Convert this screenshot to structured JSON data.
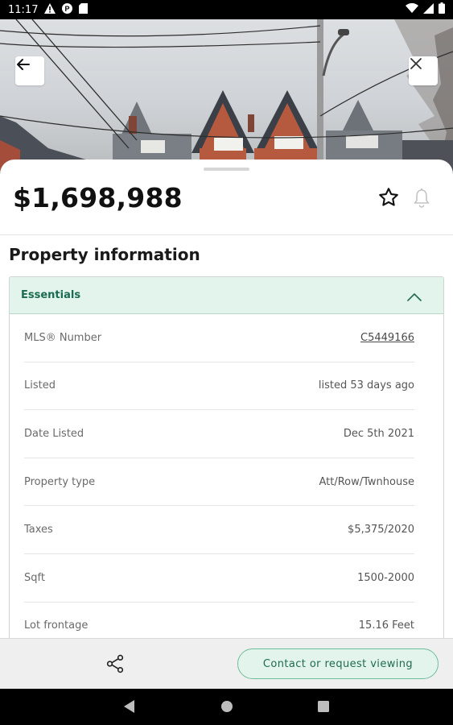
{
  "status_bar": {
    "time": "11:17",
    "left_icons": [
      "alert-icon",
      "parking-app-icon",
      "sd-card-icon"
    ],
    "right_icons": [
      "wifi-icon",
      "cellular-signal-icon",
      "battery-icon"
    ]
  },
  "hero": {
    "back_icon": "arrow-left-icon",
    "close_icon": "close-icon"
  },
  "listing": {
    "price": "$1,698,988",
    "favorite_icon": "star-outline-icon",
    "alert_icon": "bell-icon"
  },
  "property_information": {
    "title": "Property information",
    "section": {
      "title": "Essentials",
      "expanded": true,
      "rows": [
        {
          "label": "MLS® Number",
          "value": "C5449166",
          "link": true
        },
        {
          "label": "Listed",
          "value": "listed 53 days ago",
          "link": false
        },
        {
          "label": "Date Listed",
          "value": "Dec 5th 2021",
          "link": false
        },
        {
          "label": "Property type",
          "value": "Att/Row/Twnhouse",
          "link": false
        },
        {
          "label": "Taxes",
          "value": "$5,375/2020",
          "link": false
        },
        {
          "label": "Sqft",
          "value": "1500-2000",
          "link": false
        },
        {
          "label": "Lot frontage",
          "value": "15.16 Feet",
          "link": false
        }
      ]
    }
  },
  "action_bar": {
    "share_icon": "share-icon",
    "contact_label": "Contact or request viewing"
  },
  "colors": {
    "accent": "#1e6b50",
    "accent_light": "#e2f4ec",
    "accent_border": "#6cbf9c"
  }
}
